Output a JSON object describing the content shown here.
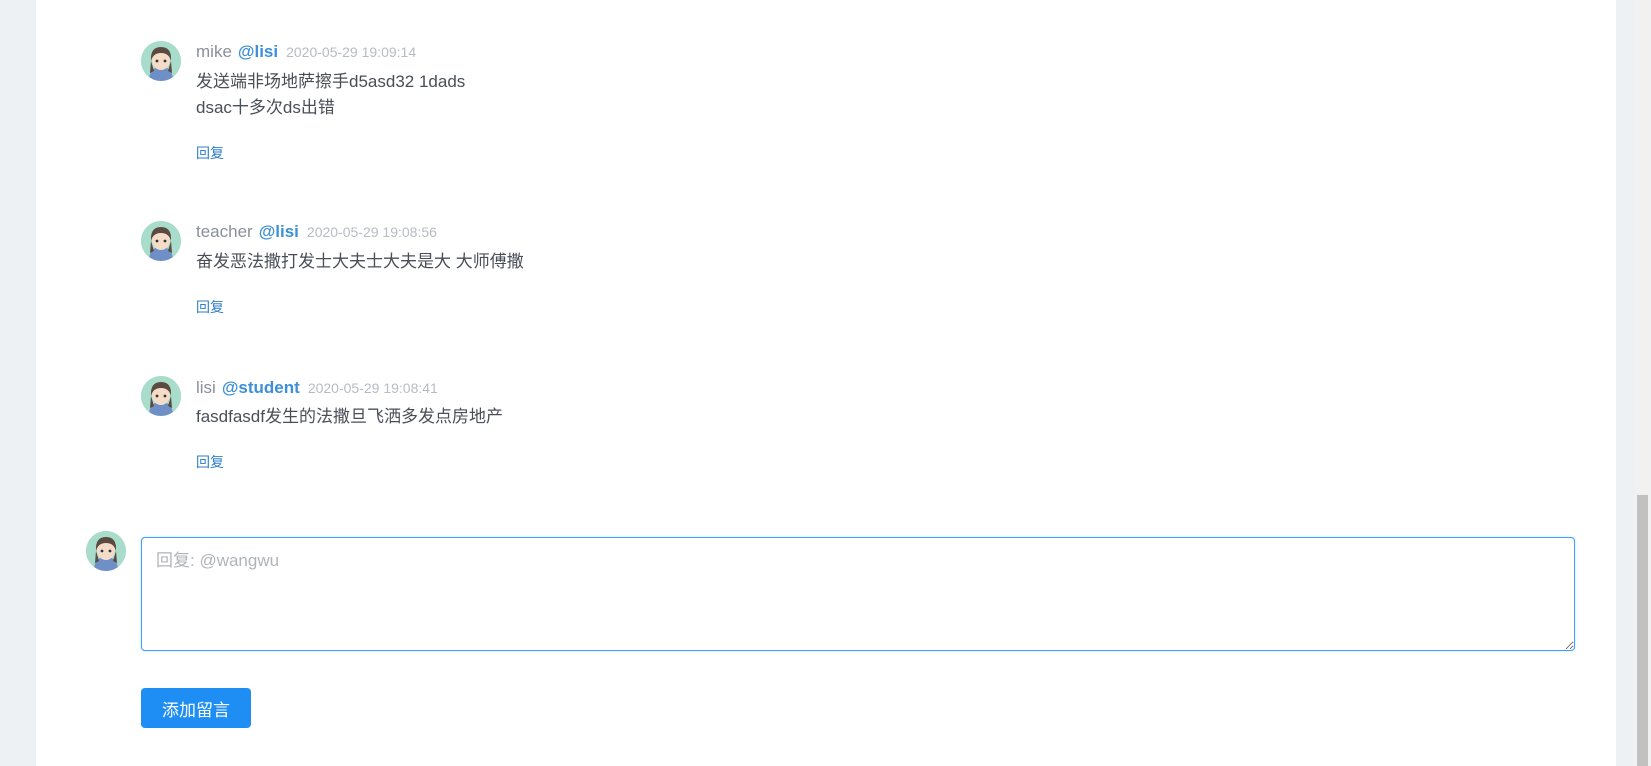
{
  "comments": [
    {
      "author": "mike",
      "mention": "@lisi",
      "time": "2020-05-29 19:09:14",
      "content": "发送端非场地萨擦手d5asd32 1dads\ndsac十多次ds出错",
      "reply_label": "回复"
    },
    {
      "author": "teacher",
      "mention": "@lisi",
      "time": "2020-05-29 19:08:56",
      "content": "奋发恶法撒打发士大夫士大夫是大 大师傅撒",
      "reply_label": "回复"
    },
    {
      "author": "lisi",
      "mention": "@student",
      "time": "2020-05-29 19:08:41",
      "content": "fasdfasdf发生的法撒旦飞洒多发点房地产",
      "reply_label": "回复"
    }
  ],
  "reply_form": {
    "placeholder": "回复: @wangwu",
    "value": "",
    "submit_label": "添加留言"
  },
  "icons": {
    "avatar": "anime-girl-avatar-icon"
  },
  "colors": {
    "accent": "#1e8ef5",
    "mention": "#3d8fd9",
    "focus_border": "#409eff"
  }
}
